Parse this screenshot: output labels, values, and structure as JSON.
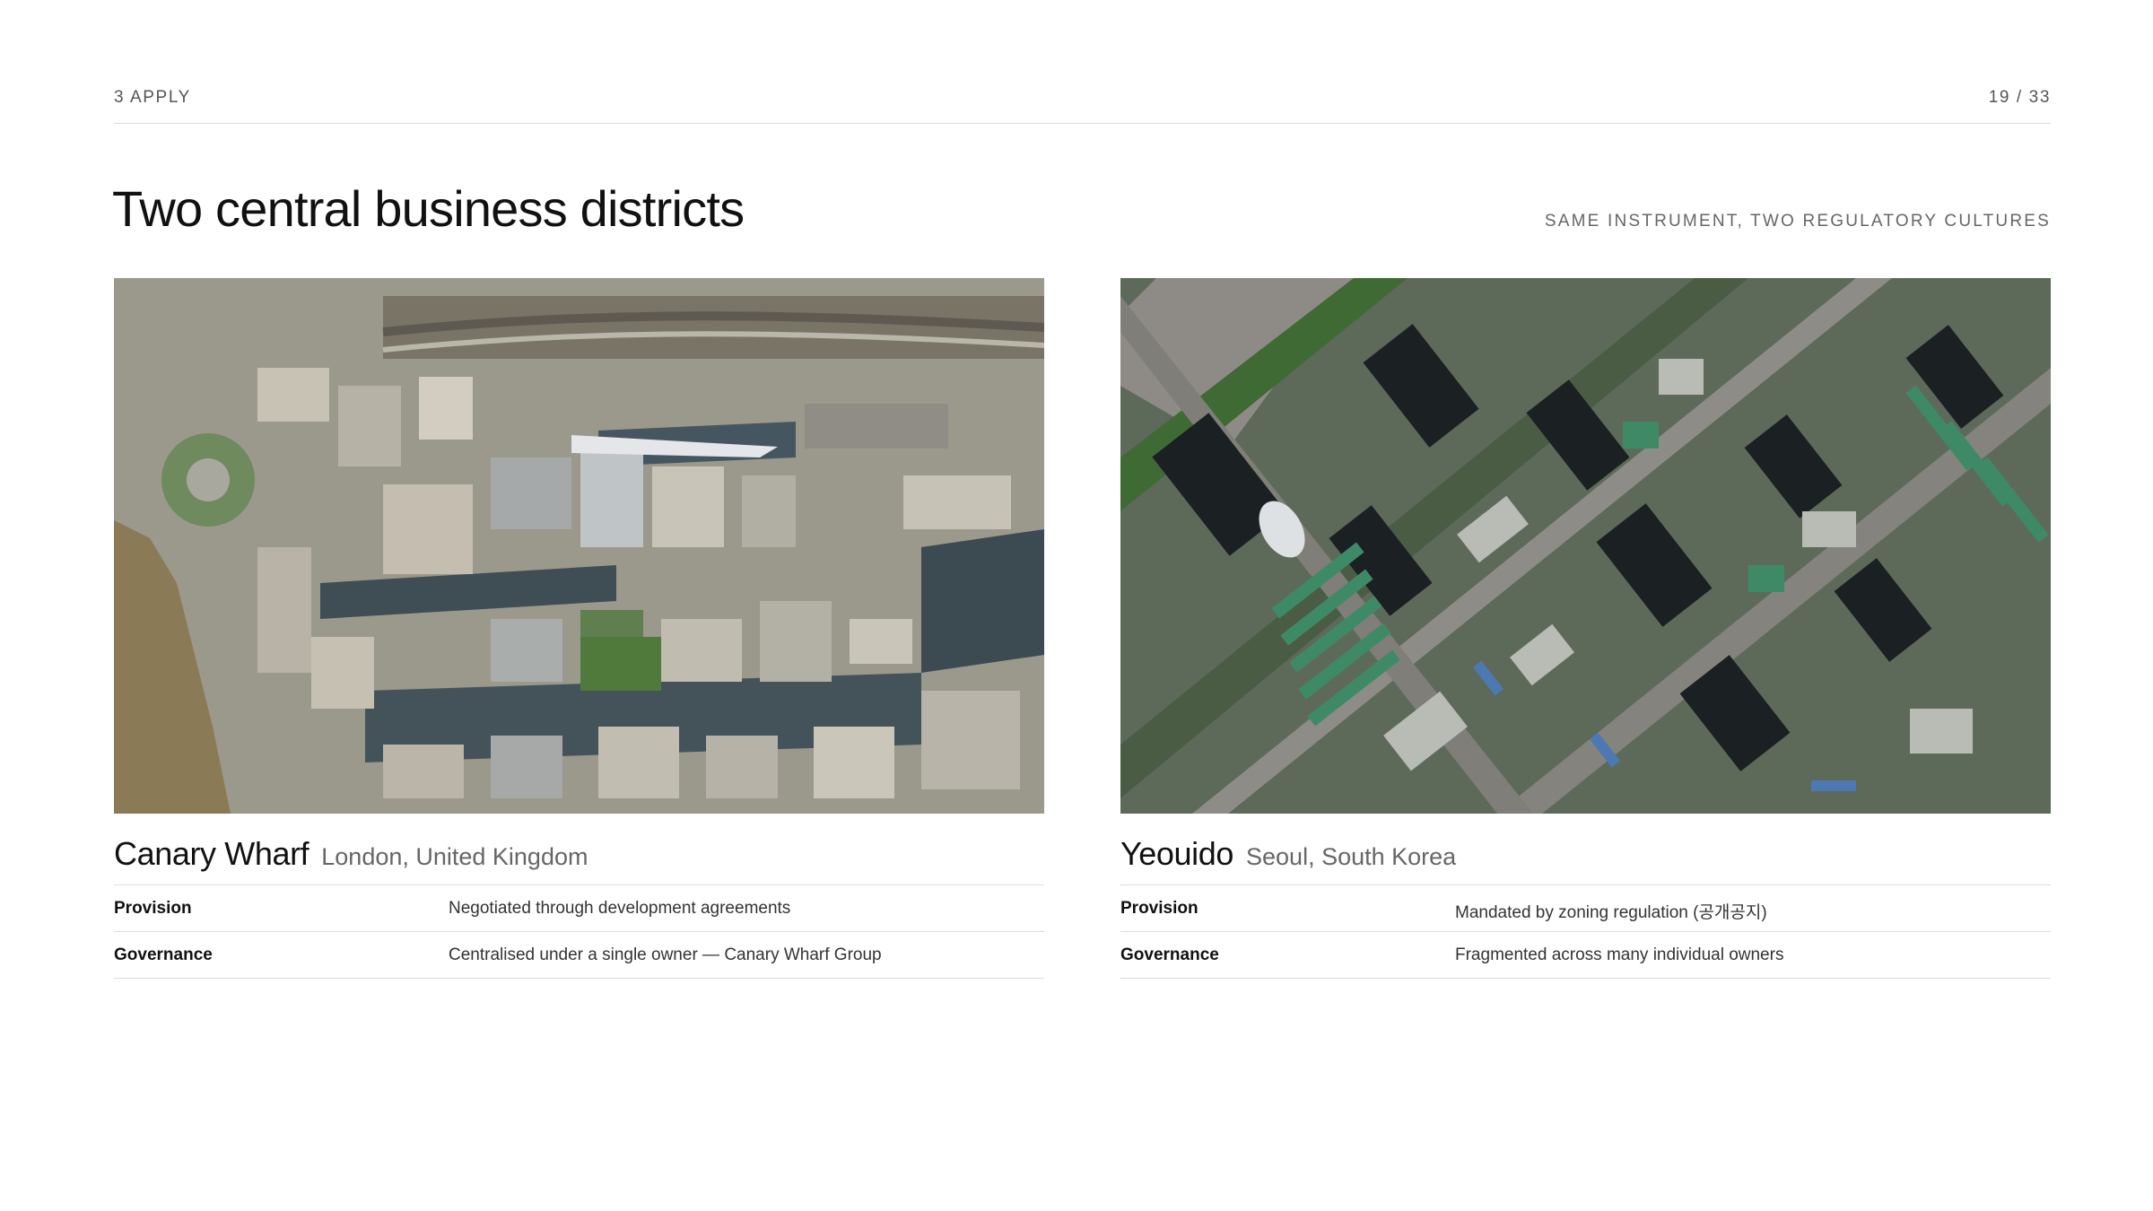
{
  "header": {
    "section": "3 APPLY",
    "page": "19 / 33"
  },
  "title": "Two central business districts",
  "subtitle": "SAME INSTRUMENT, TWO REGULATORY CULTURES",
  "districts": [
    {
      "name": "Canary Wharf",
      "location": "London, United Kingdom",
      "rows": [
        {
          "label": "Provision",
          "value": "Negotiated through development agreements"
        },
        {
          "label": "Governance",
          "value": "Centralised under a single owner — Canary Wharf Group"
        }
      ]
    },
    {
      "name": "Yeouido",
      "location": "Seoul, South Korea",
      "rows": [
        {
          "label": "Provision",
          "value": "Mandated by zoning regulation (공개공지)"
        },
        {
          "label": "Governance",
          "value": "Fragmented across many individual owners"
        }
      ]
    }
  ]
}
